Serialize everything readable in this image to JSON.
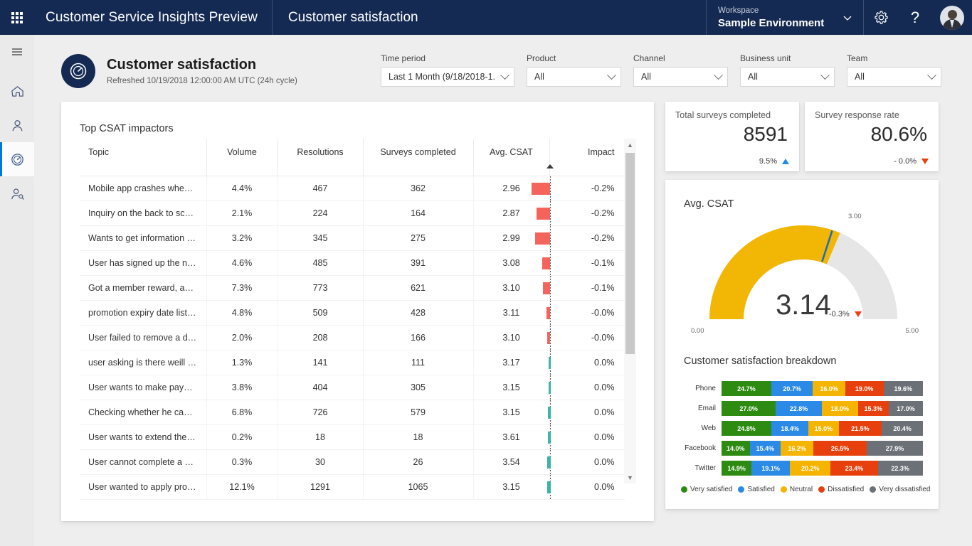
{
  "topbar": {
    "waffle_icon": "app-launcher-icon",
    "brand": "Customer Service Insights Preview",
    "page_tab": "Customer satisfaction",
    "workspace_label": "Workspace",
    "workspace_value": "Sample Environment",
    "settings_icon": "gear-icon",
    "help_icon": "question-mark-icon",
    "avatar_icon": "user-avatar",
    "background": "#152A52"
  },
  "rail": {
    "items": [
      {
        "name": "hamburger-menu",
        "icon": "hamburger-icon",
        "active": false
      },
      {
        "name": "home",
        "icon": "home-icon",
        "active": false
      },
      {
        "name": "agent",
        "icon": "person-icon",
        "active": false
      },
      {
        "name": "customer-satisfaction",
        "icon": "gauge-icon",
        "active": true
      },
      {
        "name": "customer",
        "icon": "person-search-icon",
        "active": false
      }
    ],
    "active_accent": "#0078d4"
  },
  "page": {
    "badge_icon": "gauge-icon",
    "title": "Customer satisfaction",
    "subtitle": "Refreshed 10/19/2018 12:00:00 AM UTC (24h cycle)"
  },
  "filters": [
    {
      "name": "time-period",
      "label": "Time period",
      "value": "Last 1 Month (9/18/2018-1..."
    },
    {
      "name": "product",
      "label": "Product",
      "value": "All"
    },
    {
      "name": "channel",
      "label": "Channel",
      "value": "All"
    },
    {
      "name": "business-unit",
      "label": "Business unit",
      "value": "All"
    },
    {
      "name": "team",
      "label": "Team",
      "value": "All"
    }
  ],
  "table": {
    "title": "Top CSAT impactors",
    "sorted_column": "Avg. CSAT",
    "sort_direction": "ascending",
    "columns": [
      "Topic",
      "Volume",
      "Resolutions",
      "Surveys completed",
      "Avg. CSAT",
      "Impact"
    ],
    "rows": [
      {
        "topic": "Mobile app crashes when t...",
        "volume": "4.4%",
        "resolutions": "467",
        "surveys": "362",
        "csat": "2.96",
        "impact": "-0.2%",
        "impact_num": -0.22
      },
      {
        "topic": "Inquiry on the back to scho...",
        "volume": "2.1%",
        "resolutions": "224",
        "surveys": "164",
        "csat": "2.87",
        "impact": "-0.2%",
        "impact_num": -0.16
      },
      {
        "topic": "Wants to get information o...",
        "volume": "3.2%",
        "resolutions": "345",
        "surveys": "275",
        "csat": "2.99",
        "impact": "-0.2%",
        "impact_num": -0.17
      },
      {
        "topic": "User has signed up the ne...",
        "volume": "4.6%",
        "resolutions": "485",
        "surveys": "391",
        "csat": "3.08",
        "impact": "-0.1%",
        "impact_num": -0.09
      },
      {
        "topic": "Got a member reward, and ...",
        "volume": "7.3%",
        "resolutions": "773",
        "surveys": "621",
        "csat": "3.10",
        "impact": "-0.1%",
        "impact_num": -0.08
      },
      {
        "topic": "promotion expiry date liste...",
        "volume": "4.8%",
        "resolutions": "509",
        "surveys": "428",
        "csat": "3.11",
        "impact": "-0.0%",
        "impact_num": -0.04
      },
      {
        "topic": "User failed to remove a de...",
        "volume": "2.0%",
        "resolutions": "208",
        "surveys": "166",
        "csat": "3.10",
        "impact": "-0.0%",
        "impact_num": -0.03
      },
      {
        "topic": "user asking is there weill be...",
        "volume": "1.3%",
        "resolutions": "141",
        "surveys": "111",
        "csat": "3.17",
        "impact": "0.0%",
        "impact_num": 0.02
      },
      {
        "topic": "User wants to make payme...",
        "volume": "3.8%",
        "resolutions": "404",
        "surveys": "305",
        "csat": "3.15",
        "impact": "0.0%",
        "impact_num": 0.02
      },
      {
        "topic": "Checking whether he can r...",
        "volume": "6.8%",
        "resolutions": "726",
        "surveys": "579",
        "csat": "3.15",
        "impact": "0.0%",
        "impact_num": 0.03
      },
      {
        "topic": "User wants to extend the p...",
        "volume": "0.2%",
        "resolutions": "18",
        "surveys": "18",
        "csat": "3.61",
        "impact": "0.0%",
        "impact_num": 0.03
      },
      {
        "topic": "User cannot complete a pa...",
        "volume": "0.3%",
        "resolutions": "30",
        "surveys": "26",
        "csat": "3.54",
        "impact": "0.0%",
        "impact_num": 0.04
      },
      {
        "topic": "User wanted to apply prom...",
        "volume": "12.1%",
        "resolutions": "1291",
        "surveys": "1065",
        "csat": "3.15",
        "impact": "0.0%",
        "impact_num": 0.04
      }
    ],
    "bar_negative_color": "#F4645C",
    "bar_positive_color": "#3BB3A6"
  },
  "kpis": [
    {
      "name": "total-surveys-completed",
      "label": "Total surveys completed",
      "value": "8591",
      "delta": "9.5%",
      "direction": "up",
      "delta_color": "#1f8ce8"
    },
    {
      "name": "survey-response-rate",
      "label": "Survey response rate",
      "value": "80.6%",
      "delta": "- 0.0%",
      "direction": "down",
      "delta_color": "#e8400c"
    }
  ],
  "chart_data": [
    {
      "type": "gauge",
      "title": "Avg. CSAT",
      "value": 3.14,
      "value_label": "3.14",
      "min": 0.0,
      "min_label": "0.00",
      "max": 5.0,
      "max_label": "5.00",
      "target": 3.0,
      "target_label": "3.00",
      "delta": "-0.3%",
      "delta_direction": "down",
      "fill_color": "#F2B705",
      "track_color": "#e6e6e6",
      "target_color": "#1f6fb4"
    },
    {
      "type": "bar",
      "subtype": "stacked-horizontal-100",
      "title": "Customer satisfaction breakdown",
      "categories": [
        "Phone",
        "Email",
        "Web",
        "Facebook",
        "Twitter"
      ],
      "xlabel": "",
      "ylabel": "",
      "grid": false,
      "legend_position": "bottom",
      "series": [
        {
          "name": "Very satisfied",
          "color": "#2E8B12",
          "values": [
            24.7,
            27.0,
            24.8,
            14.0,
            14.9
          ],
          "labels": [
            "24.7%",
            "27.0%",
            "24.8%",
            "14.0%",
            "14.9%"
          ]
        },
        {
          "name": "Satisfied",
          "color": "#2A8AE5",
          "values": [
            20.7,
            22.8,
            18.4,
            15.4,
            19.1
          ],
          "labels": [
            "20.7%",
            "22.8%",
            "18.4%",
            "15.4%",
            "19.1%"
          ]
        },
        {
          "name": "Neutral",
          "color": "#F5B400",
          "values": [
            16.0,
            18.0,
            15.0,
            16.2,
            20.2
          ],
          "labels": [
            "16.0%",
            "18.0%",
            "15.0%",
            "16.2%",
            "20.2%"
          ]
        },
        {
          "name": "Dissatisfied",
          "color": "#E8400C",
          "values": [
            19.0,
            15.3,
            21.5,
            26.5,
            23.4
          ],
          "labels": [
            "19.0%",
            "15.3%",
            "21.5%",
            "26.5%",
            "23.4%"
          ]
        },
        {
          "name": "Very dissatisfied",
          "color": "#6B7176",
          "values": [
            19.6,
            17.0,
            20.4,
            27.9,
            22.3
          ],
          "labels": [
            "19.6%",
            "17.0%",
            "20.4%",
            "27.9%",
            "22.3%"
          ]
        }
      ]
    }
  ]
}
